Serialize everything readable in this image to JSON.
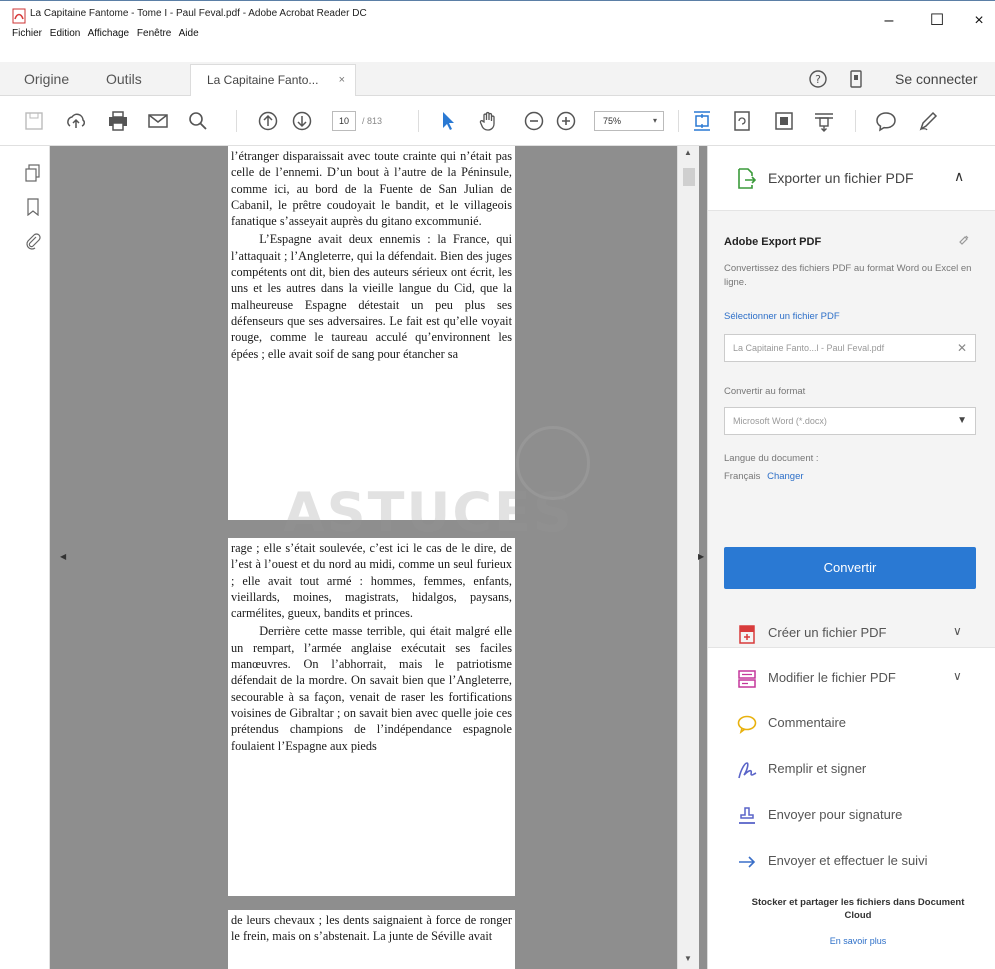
{
  "window": {
    "title": "La Capitaine Fantome - Tome I - Paul Feval.pdf - Adobe Acrobat Reader DC",
    "minimize": "–",
    "maximize": "☐",
    "close": "×"
  },
  "menu": [
    "Fichier",
    "Edition",
    "Affichage",
    "Fenêtre",
    "Aide"
  ],
  "tabs": {
    "home": "Origine",
    "tools": "Outils",
    "document": "La Capitaine Fanto...",
    "close": "×",
    "sign_in": "Se connecter"
  },
  "toolbar": {
    "page_current": "10",
    "page_total": "/ 813",
    "zoom": "75%"
  },
  "document": {
    "page1": [
      "l’étranger disparaissait avec toute crainte qui n’était pas celle de l’ennemi. D’un bout à l’autre de la Péninsule, comme ici, au bord de la Fuente de San Julian de Cabanil, le prêtre coudoyait le bandit, et le villageois fanatique s’asseyait auprès du gitano excommunié.",
      "L’Espagne avait deux ennemis : la France, qui l’attaquait ; l’Angleterre, qui la défendait. Bien des juges compétents ont dit, bien des auteurs sérieux ont écrit, les uns et les autres dans la vieille langue du Cid, que la malheureuse Espagne détestait un peu plus ses défenseurs que ses adversaires. Le fait est qu’elle voyait rouge, comme le taureau acculé qu’environnent les épées ; elle avait soif de sang pour étancher sa"
    ],
    "page2": [
      "rage ; elle s’était soulevée, c’est ici le cas de le dire, de l’est à l’ouest et du nord au midi, comme un seul furieux ; elle avait tout armé : hommes, femmes, enfants, vieillards, moines, magistrats, hidalgos, paysans, carmélites, gueux, bandits et princes.",
      "Derrière cette masse terrible, qui était malgré elle un rempart, l’armée anglaise exécutait ses faciles manœuvres. On l’abhorrait, mais le patriotisme défendait de la mordre. On savait bien que l’Angleterre, secourable à sa façon, venait de raser les fortifications voisines de Gibraltar ; on savait bien avec quelle joie ces prétendus champions de l’indépendance espagnole foulaient l’Espagne aux pieds"
    ],
    "page3": [
      "de leurs chevaux ; les dents saignaient à force de ronger le frein, mais on s’abstenait. La junte de Séville avait"
    ],
    "watermark": "ASTUCES"
  },
  "right_pane": {
    "export_header": "Exporter un fichier PDF",
    "panel_title": "Adobe Export PDF",
    "panel_desc": "Convertissez des fichiers PDF au format Word ou Excel en ligne.",
    "select_link": "Sélectionner un fichier PDF",
    "file_value": "La Capitaine Fanto...l - Paul Feval.pdf",
    "convert_to_label": "Convertir au format",
    "format_value": "Microsoft Word (*.docx)",
    "language_label": "Langue du document :",
    "language_value": "Français",
    "language_change": "Changer",
    "convert_button": "Convertir",
    "tools": [
      {
        "label": "Créer un fichier PDF",
        "chevron": true
      },
      {
        "label": "Modifier le fichier PDF",
        "chevron": true
      },
      {
        "label": "Commentaire",
        "chevron": false
      },
      {
        "label": "Remplir et signer",
        "chevron": false
      },
      {
        "label": "Envoyer pour signature",
        "chevron": false
      },
      {
        "label": "Envoyer et effectuer le suivi",
        "chevron": false
      }
    ],
    "cloud_text": "Stocker et partager les fichiers dans Document Cloud",
    "cloud_link": "En savoir plus"
  },
  "colors": {
    "accent": "#2a79d3",
    "pdf_red": "#d83b3b",
    "panel_bg": "#f4f4f4",
    "doc_bg": "#8e8e8e"
  }
}
